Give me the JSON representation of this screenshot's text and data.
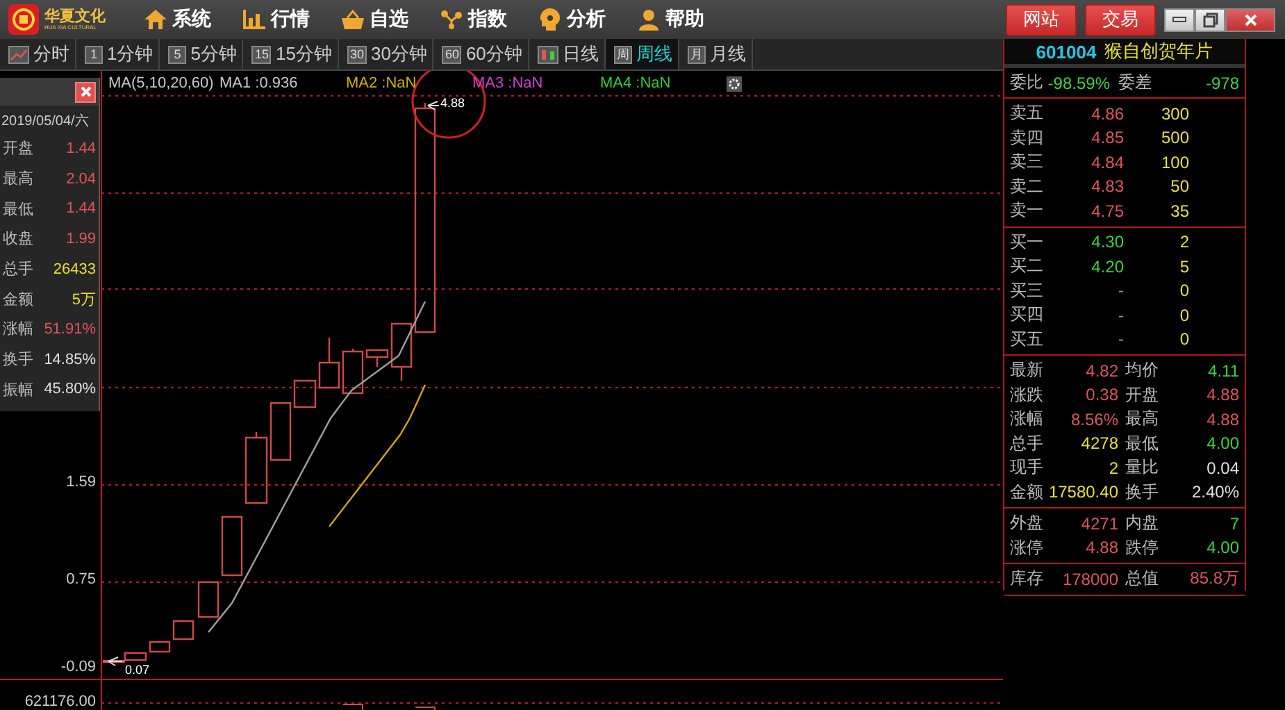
{
  "app": {
    "logo_text": "华夏文化",
    "logo_subtext": "HUA XIA CULTURAL"
  },
  "menu": [
    {
      "label": "系统"
    },
    {
      "label": "行情"
    },
    {
      "label": "自选"
    },
    {
      "label": "指数"
    },
    {
      "label": "分析"
    },
    {
      "label": "帮助"
    }
  ],
  "header_buttons": [
    "网站",
    "交易"
  ],
  "period_tabs": [
    {
      "kind": "icon",
      "label": "分时",
      "selected": false
    },
    {
      "kind": "badge",
      "badge": "1",
      "label": "1分钟",
      "selected": false
    },
    {
      "kind": "badge",
      "badge": "5",
      "label": "5分钟",
      "selected": false
    },
    {
      "kind": "badge",
      "badge": "15",
      "label": "15分钟",
      "selected": false
    },
    {
      "kind": "badge",
      "badge": "30",
      "label": "30分钟",
      "selected": false
    },
    {
      "kind": "badge",
      "badge": "60",
      "label": "60分钟",
      "selected": false
    },
    {
      "kind": "candle",
      "label": "日线",
      "selected": false
    },
    {
      "kind": "badge",
      "badge": "周",
      "label": "周线",
      "selected": true
    },
    {
      "kind": "badge",
      "badge": "月",
      "label": "月线",
      "selected": false
    }
  ],
  "indicators": [
    {
      "text": "MA(5,10,20,60)",
      "color": "#c8c8c8"
    },
    {
      "text": "MA1 :0.936",
      "color": "#c8c8c8"
    },
    {
      "text": "MA2 :NaN",
      "color": "#d4b000"
    },
    {
      "text": "MA3 :NaN",
      "color": "#d040d0"
    },
    {
      "text": "MA4 :NaN",
      "color": "#30d030"
    }
  ],
  "info_panel": {
    "date": "2019/05/04/六",
    "rows": [
      {
        "label": "开盘",
        "value": "1.44",
        "color": "#e05555"
      },
      {
        "label": "最高",
        "value": "2.04",
        "color": "#e05555"
      },
      {
        "label": "最低",
        "value": "1.44",
        "color": "#e05555"
      },
      {
        "label": "收盘",
        "value": "1.99",
        "color": "#e05555"
      },
      {
        "label": "总手",
        "value": "26433",
        "color": "#e8e030"
      },
      {
        "label": "金额",
        "value": "5万",
        "color": "#e8e030"
      },
      {
        "label": "涨幅",
        "value": "51.91%",
        "color": "#e05555"
      },
      {
        "label": "换手",
        "value": "14.85%",
        "color": "#e0e0e0"
      },
      {
        "label": "振幅",
        "value": "45.80%",
        "color": "#e0e0e0"
      }
    ]
  },
  "chart": {
    "y_labels": [
      "1.59",
      "0.75",
      "-0.09"
    ],
    "high_marker": "4.88",
    "low_marker": "0.07",
    "volume_label": "621176.00"
  },
  "quote": {
    "code": "601004",
    "name": "猴自创贺年片"
  },
  "order_book": {
    "ratio_label": "委比",
    "ratio": "-98.59%",
    "diff_label": "委差",
    "diff": "-978",
    "asks": [
      {
        "label": "卖五",
        "price": "4.86",
        "volume": "300"
      },
      {
        "label": "卖四",
        "price": "4.85",
        "volume": "500"
      },
      {
        "label": "卖三",
        "price": "4.84",
        "volume": "100"
      },
      {
        "label": "卖二",
        "price": "4.83",
        "volume": "50"
      },
      {
        "label": "卖一",
        "price": "4.75",
        "volume": "35"
      }
    ],
    "bids": [
      {
        "label": "买一",
        "price": "4.30",
        "volume": "2"
      },
      {
        "label": "买二",
        "price": "4.20",
        "volume": "5"
      },
      {
        "label": "买三",
        "price": "-",
        "volume": "0"
      },
      {
        "label": "买四",
        "price": "-",
        "volume": "0"
      },
      {
        "label": "买五",
        "price": "-",
        "volume": "0"
      }
    ]
  },
  "stats": [
    [
      {
        "label": "最新",
        "value": "4.82",
        "color": "#e05555"
      },
      {
        "label": "均价",
        "value": "4.11",
        "color": "#3cd23c"
      }
    ],
    [
      {
        "label": "涨跌",
        "value": "0.38",
        "color": "#e05555"
      },
      {
        "label": "开盘",
        "value": "4.88",
        "color": "#e05555"
      }
    ],
    [
      {
        "label": "涨幅",
        "value": "8.56%",
        "color": "#e05555"
      },
      {
        "label": "最高",
        "value": "4.88",
        "color": "#e05555"
      }
    ],
    [
      {
        "label": "总手",
        "value": "4278",
        "color": "#e8e030"
      },
      {
        "label": "最低",
        "value": "4.00",
        "color": "#3cd23c"
      }
    ],
    [
      {
        "label": "现手",
        "value": "2",
        "color": "#e8e030"
      },
      {
        "label": "量比",
        "value": "0.04",
        "color": "#e0e0e0"
      }
    ],
    [
      {
        "label": "金额",
        "value": "17580.40",
        "color": "#e8e030"
      },
      {
        "label": "换手",
        "value": "2.40%",
        "color": "#e0e0e0"
      }
    ]
  ],
  "trade": [
    [
      {
        "label": "外盘",
        "value": "4271",
        "color": "#e05555"
      },
      {
        "label": "内盘",
        "value": "7",
        "color": "#3cd23c"
      }
    ],
    [
      {
        "label": "涨停",
        "value": "4.88",
        "color": "#e05555"
      },
      {
        "label": "跌停",
        "value": "4.00",
        "color": "#3cd23c"
      }
    ]
  ],
  "holdings": [
    [
      {
        "label": "库存",
        "value": "178000",
        "color": "#e05555"
      },
      {
        "label": "总值",
        "value": "85.8万",
        "color": "#e05555"
      }
    ]
  ]
}
